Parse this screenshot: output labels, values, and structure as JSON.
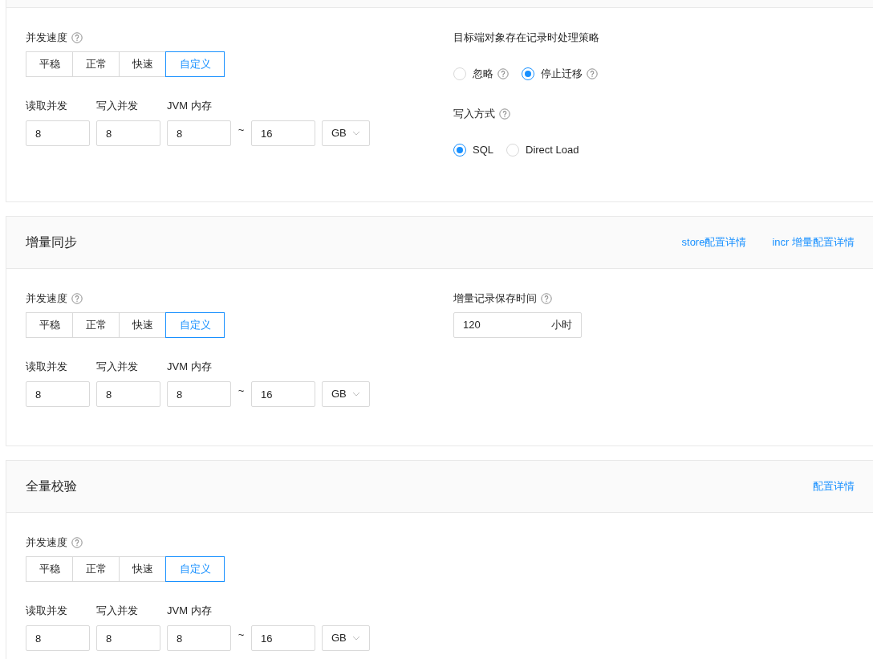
{
  "sections": [
    {
      "speed": {
        "label": "并发速度",
        "options": [
          {
            "label": "平稳",
            "selected": false
          },
          {
            "label": "正常",
            "selected": false
          },
          {
            "label": "快速",
            "selected": false
          },
          {
            "label": "自定义",
            "selected": true
          }
        ]
      },
      "read_label": "读取并发",
      "write_label": "写入并发",
      "jvm_label": "JVM 内存",
      "read_value": "8",
      "write_value": "8",
      "jvm_min": "8",
      "tilde": "~",
      "jvm_max": "16",
      "unit": "GB",
      "right": {
        "kind": "radio_groups",
        "groups": [
          {
            "label": "目标端对象存在记录时处理策略",
            "help": false,
            "options": [
              {
                "label": "忽略",
                "help": true,
                "selected": false
              },
              {
                "label": "停止迁移",
                "help": true,
                "selected": true
              }
            ]
          },
          {
            "label": "写入方式",
            "help": true,
            "options": [
              {
                "label": "SQL",
                "help": false,
                "selected": true
              },
              {
                "label": "Direct Load",
                "help": false,
                "selected": false
              }
            ]
          }
        ]
      }
    },
    {
      "title": "增量同步",
      "links": [
        "store配置详情",
        "incr 增量配置详情"
      ],
      "speed": {
        "label": "并发速度",
        "options": [
          {
            "label": "平稳",
            "selected": false
          },
          {
            "label": "正常",
            "selected": false
          },
          {
            "label": "快速",
            "selected": false
          },
          {
            "label": "自定义",
            "selected": true
          }
        ]
      },
      "read_label": "读取并发",
      "write_label": "写入并发",
      "jvm_label": "JVM 内存",
      "read_value": "8",
      "write_value": "8",
      "jvm_min": "8",
      "tilde": "~",
      "jvm_max": "16",
      "unit": "GB",
      "right": {
        "kind": "retention",
        "label": "增量记录保存时间",
        "value": "120",
        "suffix": "小时"
      }
    },
    {
      "title": "全量校验",
      "links": [
        "配置详情"
      ],
      "speed": {
        "label": "并发速度",
        "options": [
          {
            "label": "平稳",
            "selected": false
          },
          {
            "label": "正常",
            "selected": false
          },
          {
            "label": "快速",
            "selected": false
          },
          {
            "label": "自定义",
            "selected": true
          }
        ]
      },
      "read_label": "读取并发",
      "write_label": "写入并发",
      "jvm_label": "JVM 内存",
      "read_value": "8",
      "write_value": "8",
      "jvm_min": "8",
      "tilde": "~",
      "jvm_max": "16",
      "unit": "GB"
    }
  ]
}
